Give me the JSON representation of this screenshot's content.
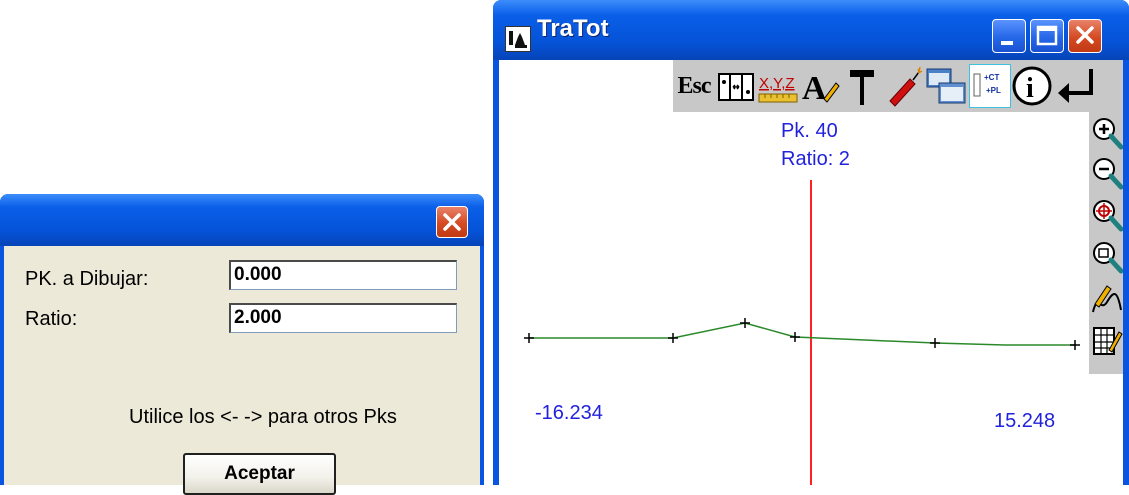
{
  "dialog": {
    "pk_label": "PK. a Dibujar:",
    "pk_value": "0.000",
    "ratio_label": "Ratio:",
    "ratio_value": "2.000",
    "hint": "Utilice los <- -> para otros Pks",
    "accept_label": "Aceptar"
  },
  "window": {
    "title": "TraTot",
    "toolbar": [
      {
        "icon": "escape-icon",
        "text": "Esc"
      },
      {
        "icon": "columns-icon"
      },
      {
        "icon": "xyz-icon",
        "text": "X,Y,Z"
      },
      {
        "icon": "text-pencil-icon",
        "text": "A"
      },
      {
        "icon": "hammer-icon"
      },
      {
        "icon": "dynamite-icon"
      },
      {
        "icon": "windows-icon"
      },
      {
        "icon": "ct-pl-icon",
        "text": "+CT +PL"
      },
      {
        "icon": "info-icon",
        "text": "i"
      },
      {
        "icon": "enter-icon"
      }
    ],
    "sidebar": [
      {
        "icon": "zoom-in-icon"
      },
      {
        "icon": "zoom-out-icon"
      },
      {
        "icon": "zoom-center-icon"
      },
      {
        "icon": "zoom-window-icon"
      },
      {
        "icon": "draw-profile-icon"
      },
      {
        "icon": "edit-table-icon"
      }
    ]
  },
  "plot": {
    "pk_text": "Pk. 40",
    "ratio_text": "Ratio: 2",
    "left_offset": "-16.234",
    "right_offset": "15.248",
    "colors": {
      "profile": "#2a8a2a",
      "axis": "#ff2020",
      "label": "#2222dd"
    }
  }
}
